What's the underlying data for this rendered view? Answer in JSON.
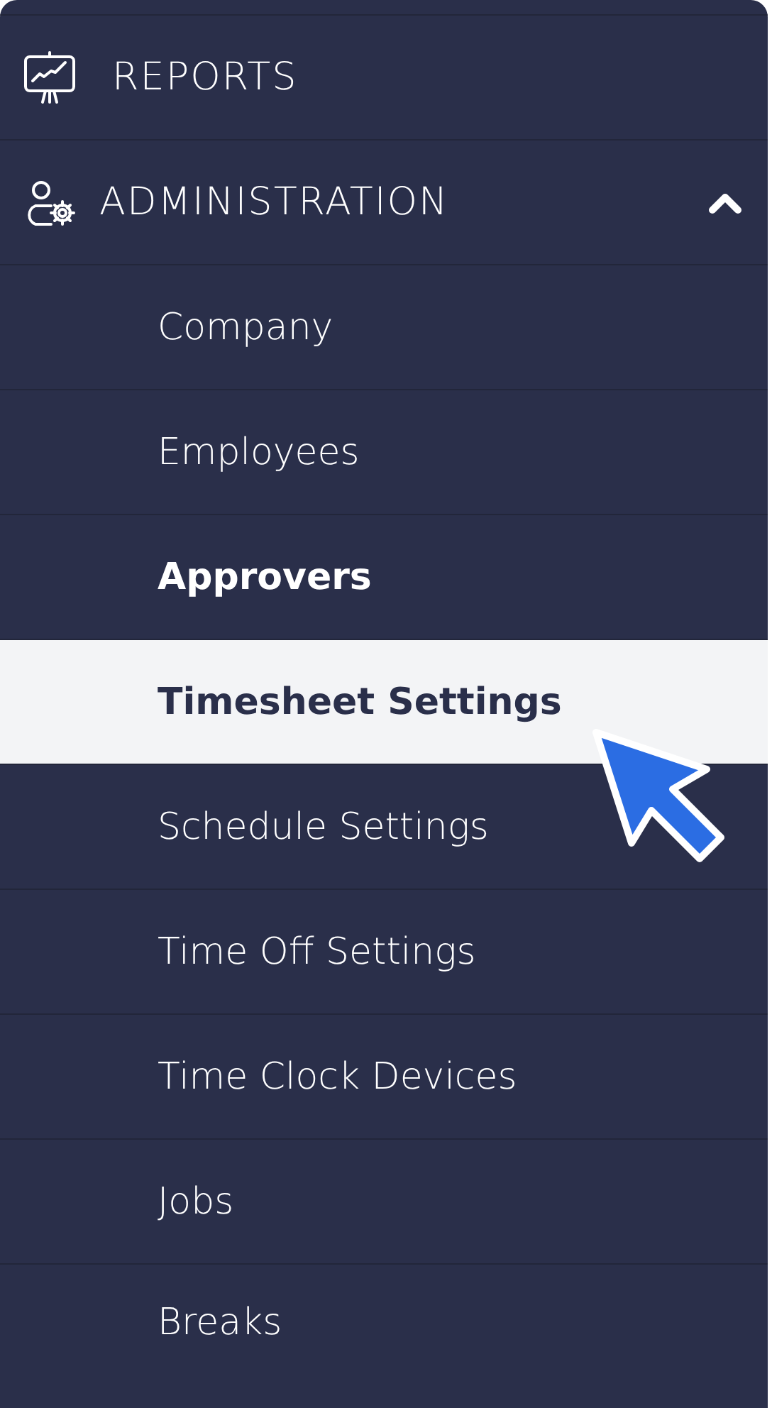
{
  "sections": [
    {
      "label": "REPORTS",
      "kind": "chart"
    },
    {
      "label": "ADMINISTRATION",
      "kind": "admin",
      "expanded": true,
      "children": [
        {
          "label": "Company",
          "selected": false,
          "current": false
        },
        {
          "label": "Employees",
          "selected": false,
          "current": false
        },
        {
          "label": "Approvers",
          "selected": false,
          "current": true
        },
        {
          "label": "Timesheet Settings",
          "selected": true,
          "current": false
        },
        {
          "label": "Schedule Settings",
          "selected": false,
          "current": false
        },
        {
          "label": "Time Off Settings",
          "selected": false,
          "current": false
        },
        {
          "label": "Time Clock Devices",
          "selected": false,
          "current": false
        },
        {
          "label": "Jobs",
          "selected": false,
          "current": false
        },
        {
          "label": "Breaks",
          "selected": false,
          "current": false
        }
      ]
    }
  ],
  "cursor": {
    "kind": "arrow"
  }
}
